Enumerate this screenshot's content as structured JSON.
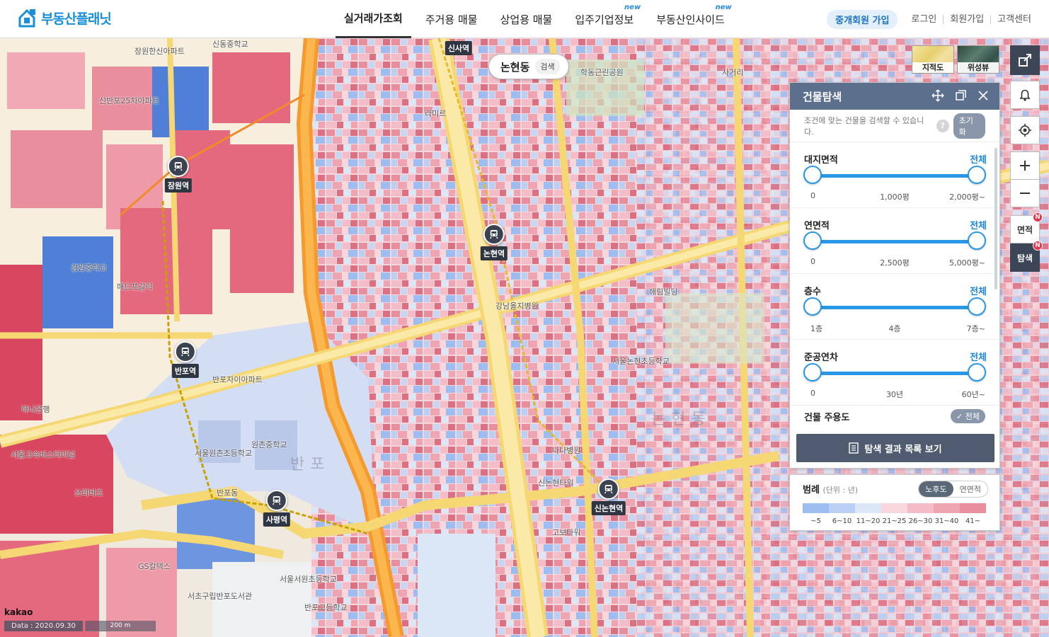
{
  "brand": {
    "name": "부동산플래닛"
  },
  "nav": [
    {
      "label": "실거래가조회",
      "new": ""
    },
    {
      "label": "주거용 매물",
      "new": ""
    },
    {
      "label": "상업용 매물",
      "new": ""
    },
    {
      "label": "입주기업정보",
      "new": "new"
    },
    {
      "label": "부동산인사이드",
      "new": "new"
    }
  ],
  "user_menu": {
    "join_broker": "중개회원 가입",
    "login": "로그인",
    "signup": "회원가입",
    "support": "고객센터"
  },
  "map_search": {
    "dong": "논현동",
    "button": "검색"
  },
  "map_types": {
    "cadastral": "지적도",
    "satellite": "위성뷰"
  },
  "rail": {
    "area": "면적",
    "explore": "탐색",
    "badge": "N"
  },
  "panel": {
    "title": "건물탐색",
    "subtitle": "조건에 맞는 건물을 검색할 수 있습니다.",
    "help": "?",
    "reset": "초기화",
    "filters": [
      {
        "title": "대지면적",
        "all": "전체",
        "min": "0",
        "mid": "1,000평",
        "max": "2,000평~"
      },
      {
        "title": "연면적",
        "all": "전체",
        "min": "0",
        "mid": "2,500평",
        "max": "5,000평~"
      },
      {
        "title": "층수",
        "all": "전체",
        "min": "1층",
        "mid": "4층",
        "max": "7층~"
      },
      {
        "title": "준공연차",
        "all": "전체",
        "min": "0",
        "mid": "30년",
        "max": "60년~"
      }
    ],
    "usage": {
      "title": "건물 주용도",
      "all": "✓ 전체"
    },
    "result_button": "탐색 결과 목록 보기"
  },
  "legend": {
    "title": "범례",
    "unit": "(단위 : 년)",
    "toggle": [
      "노후도",
      "연면적"
    ],
    "toggle_active": "노후도",
    "classes": [
      {
        "label": "~5",
        "color": "#9dbcf0"
      },
      {
        "label": "6~10",
        "color": "#b9cff3"
      },
      {
        "label": "11~20",
        "color": "#dbe6f7"
      },
      {
        "label": "21~25",
        "color": "#f7d6dc"
      },
      {
        "label": "26~30",
        "color": "#f3bcc6"
      },
      {
        "label": "31~40",
        "color": "#eea5b1"
      },
      {
        "label": "41~",
        "color": "#e98e9d"
      }
    ]
  },
  "stations": [
    {
      "name": "잠원역"
    },
    {
      "name": "논현역"
    },
    {
      "name": "반포역"
    },
    {
      "name": "사평역"
    },
    {
      "name": "신논현역"
    },
    {
      "name": "신사역"
    }
  ],
  "map_labels": [
    "신동중학교",
    "장원한신아파트",
    "라미르",
    "강남을지병원",
    "학동근린공원",
    "사거리",
    "신반포25차아파트",
    "경원중학교",
    "매드포갈릭",
    "반포자이아파트",
    "원촌중학교",
    "서울원촌초등학교",
    "서울논현초등학교",
    "나나병원",
    "서울서원초등학교",
    "반포고등학교",
    "서초구립반포도서관",
    "서울고속버스터미널",
    "쓰리버즈",
    "하나은행",
    "GS칼텍스",
    "고보타워",
    "신논현타워",
    "해림빌딩",
    "반포동",
    "논현동",
    "반포"
  ],
  "map_footer": {
    "provider": "kakao",
    "data_date": "Data : 2020.09.30",
    "scale": "200 m"
  }
}
